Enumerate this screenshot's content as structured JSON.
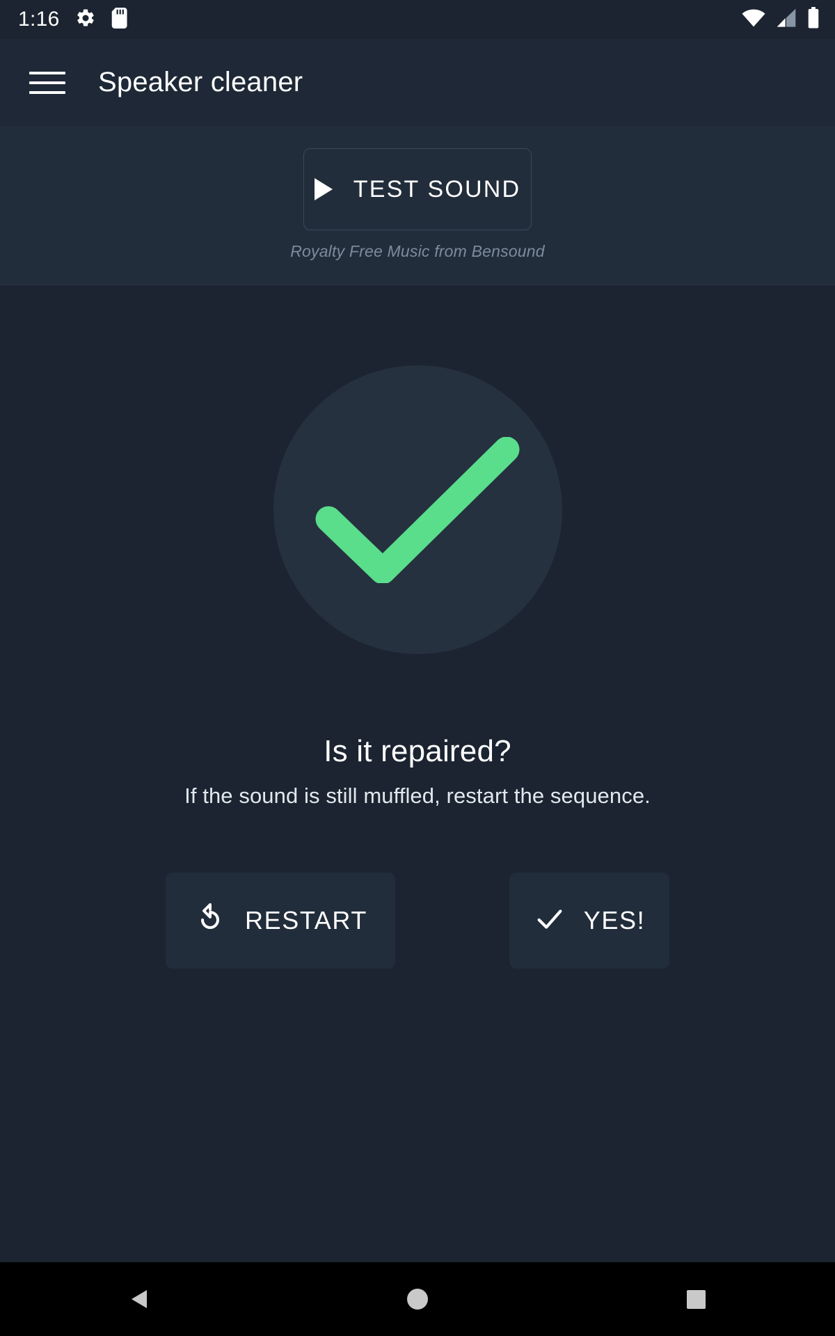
{
  "status_bar": {
    "time": "1:16",
    "left_icons": [
      "gear-icon",
      "sd-card-icon"
    ],
    "right_icons": [
      "wifi-icon",
      "cellular-signal-icon",
      "battery-icon"
    ]
  },
  "app_bar": {
    "menu_icon": "hamburger-menu-icon",
    "title": "Speaker cleaner"
  },
  "test_panel": {
    "play_icon": "play-icon",
    "button_label": "TEST SOUND",
    "caption": "Royalty Free Music from Bensound"
  },
  "result": {
    "status_icon": "check-circle-icon",
    "headline": "Is it repaired?",
    "subline": "If the sound is still muffled, restart the sequence."
  },
  "actions": {
    "restart": {
      "icon": "restart-icon",
      "label": "RESTART"
    },
    "yes": {
      "icon": "check-icon",
      "label": "YES!"
    }
  },
  "nav_bar": {
    "back": "back-triangle-icon",
    "home": "home-circle-icon",
    "recents": "recents-square-icon"
  },
  "colors": {
    "background": "#1b2430",
    "app_bar": "#1e2836",
    "panel": "#222d3b",
    "circle": "#25313f",
    "accent_green": "#5ade8c",
    "text_primary": "#ffffff",
    "text_muted": "#7d8b9b",
    "border": "#394959",
    "nav_bar": "#000000"
  }
}
